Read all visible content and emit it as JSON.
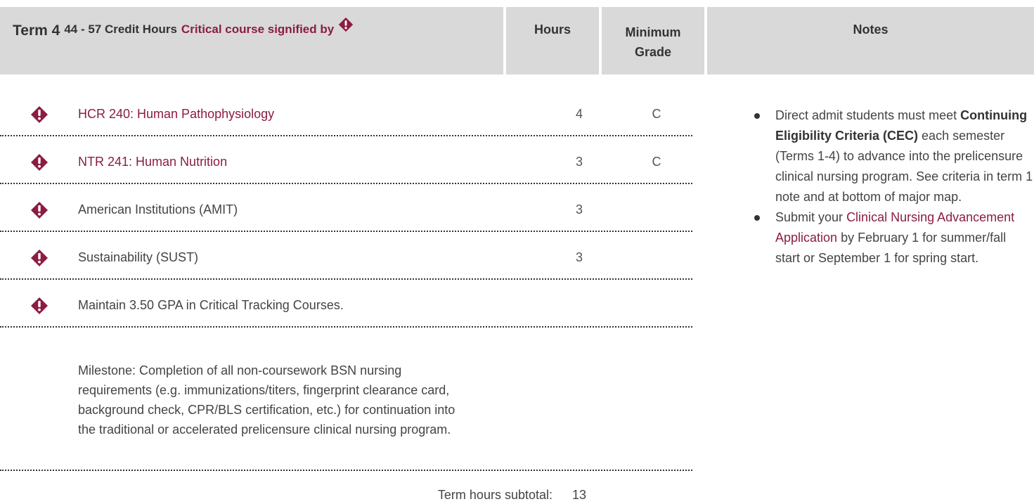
{
  "header": {
    "term_title": "Term 4",
    "credit_hours": "44 - 57 Credit Hours",
    "critical_label": "Critical course signified by",
    "hours_label": "Hours",
    "grade_label_line1": "Minimum",
    "grade_label_line2": "Grade",
    "notes_label": "Notes"
  },
  "rows": [
    {
      "course": "HCR 240: Human Pathophysiology",
      "hours": "4",
      "grade": "C",
      "critical": true,
      "link": true
    },
    {
      "course": "NTR 241: Human Nutrition",
      "hours": "3",
      "grade": "C",
      "critical": true,
      "link": true
    },
    {
      "course": "American Institutions (AMIT)",
      "hours": "3",
      "grade": "",
      "critical": true,
      "link": false
    },
    {
      "course": "Sustainability (SUST)",
      "hours": "3",
      "grade": "",
      "critical": true,
      "link": false
    },
    {
      "course": "Maintain 3.50 GPA in Critical Tracking Courses.",
      "hours": "",
      "grade": "",
      "critical": true,
      "link": false
    }
  ],
  "milestone": "Milestone: Completion of all non-coursework BSN nursing requirements (e.g. immunizations/titers, fingerprint clearance card, background check, CPR/BLS certification, etc.) for continuation into the traditional or accelerated prelicensure clinical nursing program.",
  "subtotal": {
    "label": "Term hours subtotal:",
    "value": "13"
  },
  "notes": {
    "item1_pre": "Direct admit students must meet",
    "item1_bold": "Continuing Eligibility Criteria (CEC)",
    "item1_post": "each semester (Terms 1-4) to advance into the prelicensure clinical nursing program.  See criteria in term 1 note and at bottom of major map.",
    "item2_pre": "Submit your",
    "item2_link": "Clinical Nursing Advancement Application",
    "item2_post": "by February 1 for summer/fall start or September 1 for spring start."
  },
  "colors": {
    "accent": "#8c1d40",
    "header_bg": "#d9d9d9",
    "text": "#444444"
  },
  "icons": {
    "critical": "critical-diamond-icon"
  }
}
